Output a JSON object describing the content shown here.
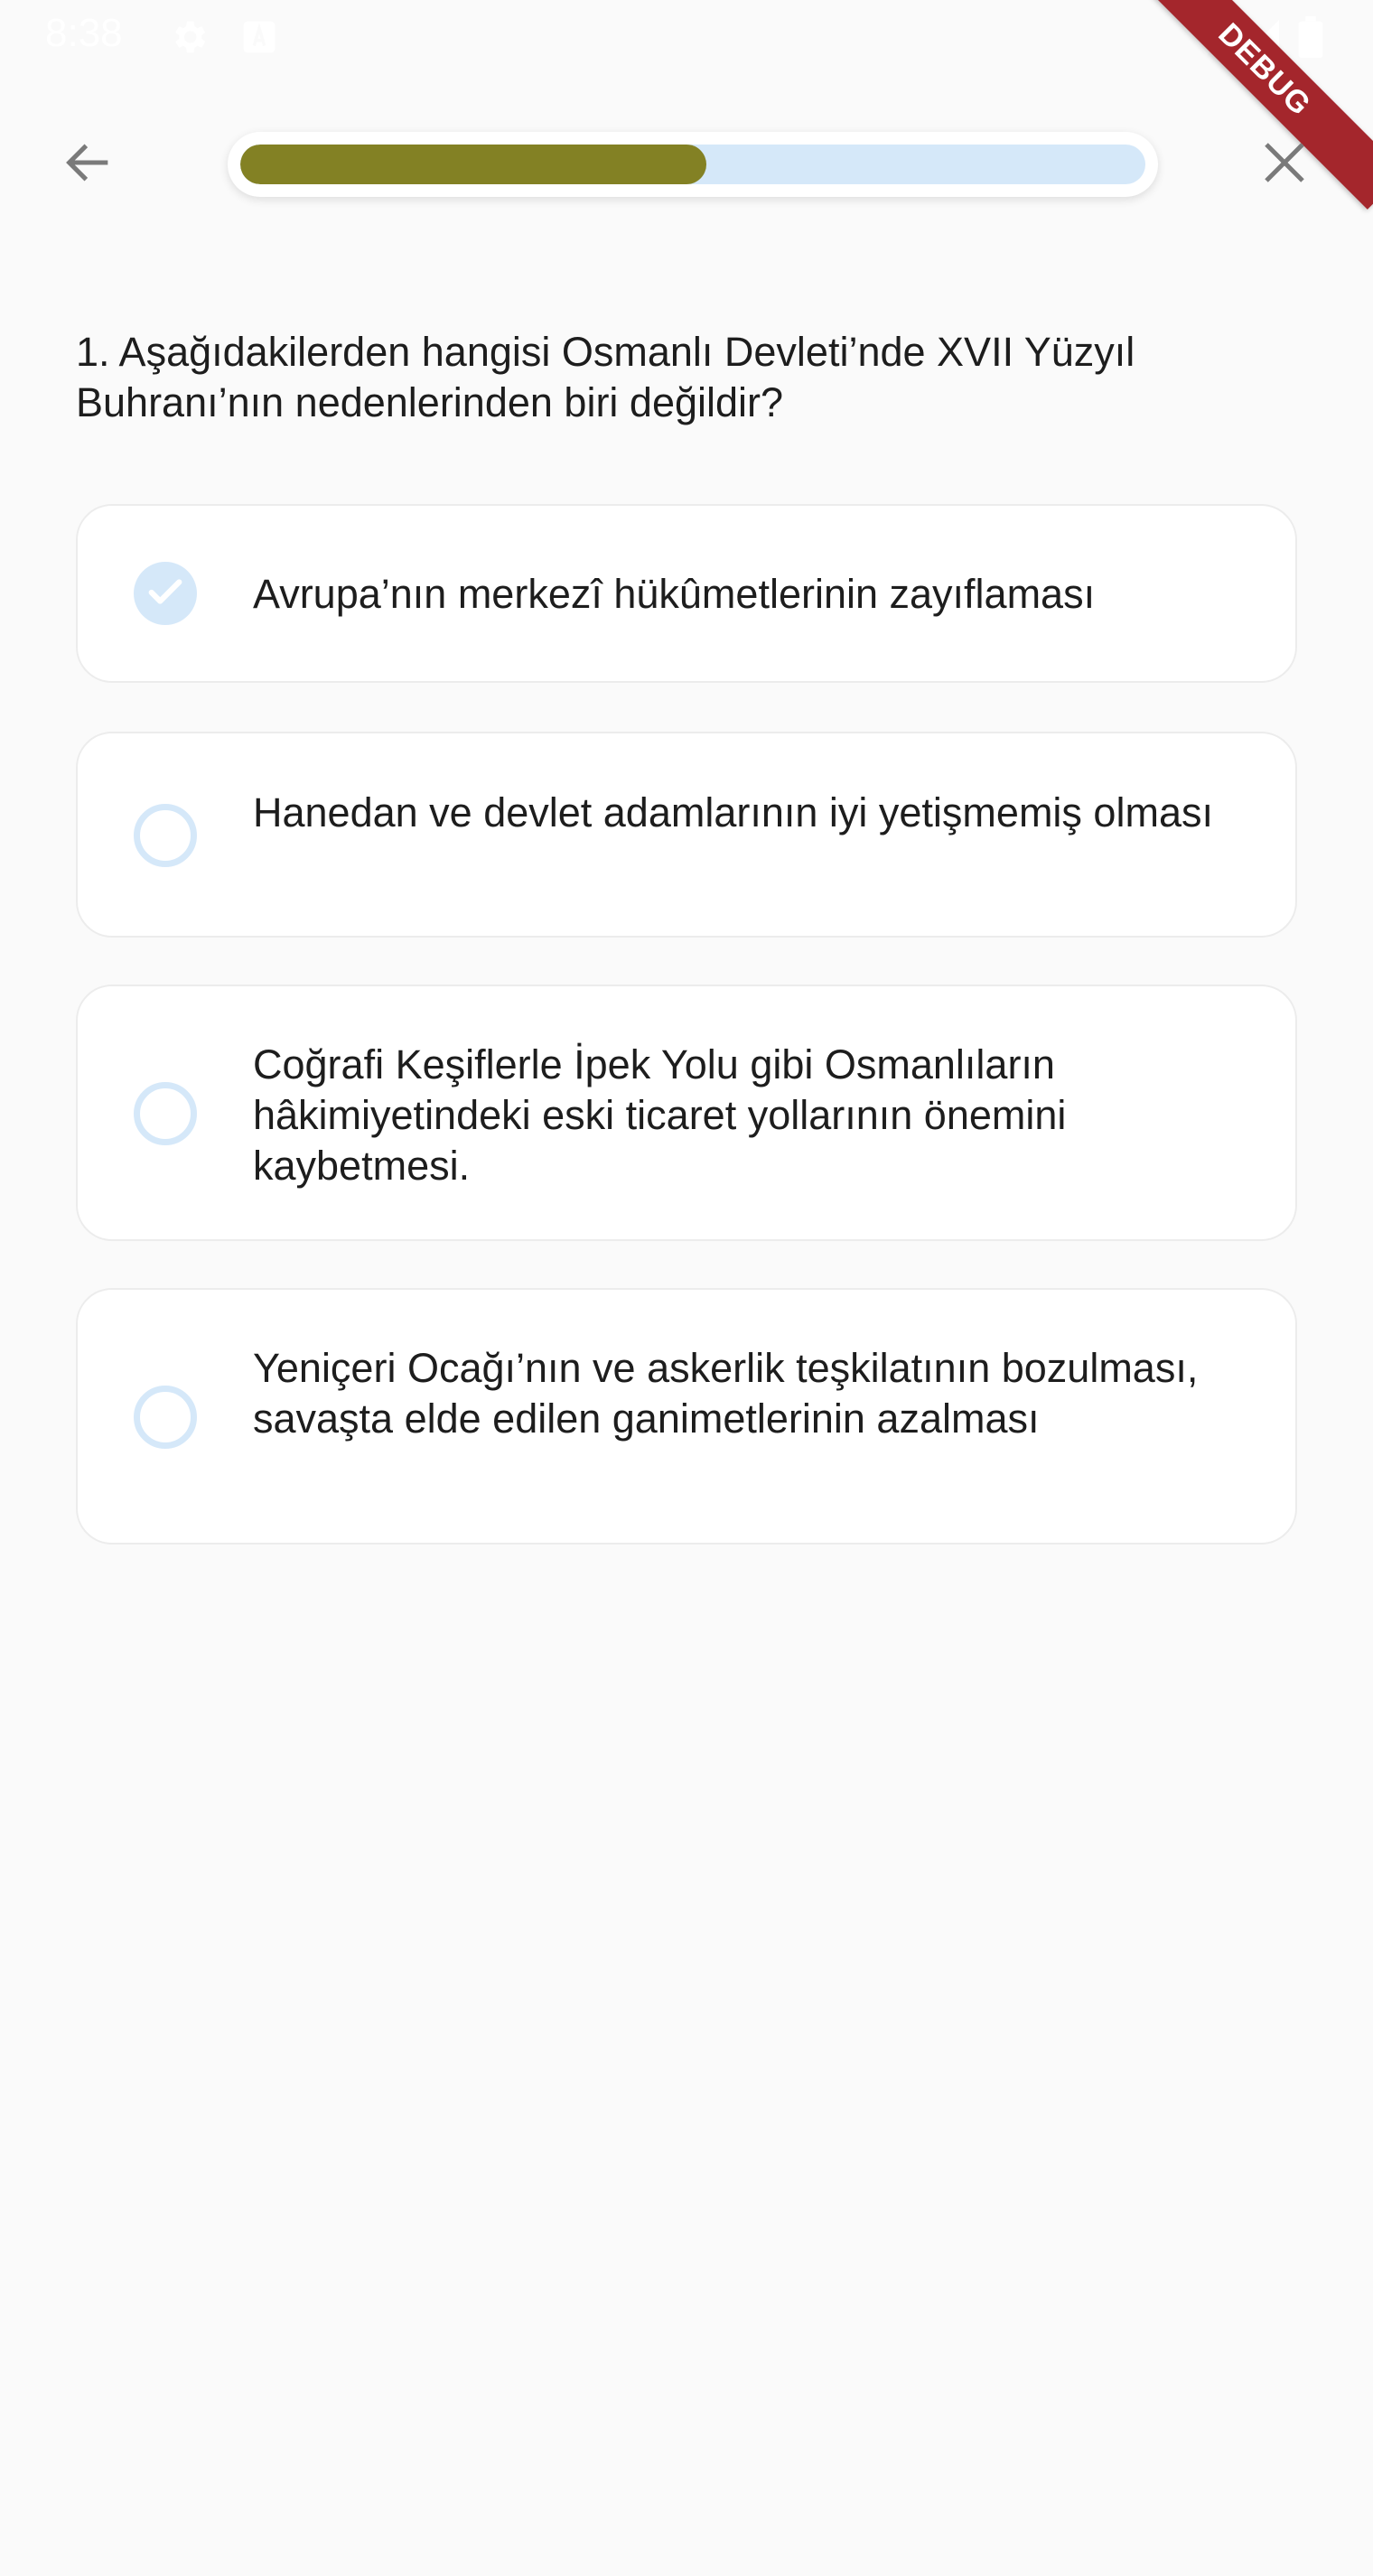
{
  "status_bar": {
    "time": "8:38",
    "icons": [
      "gear-icon",
      "font-icon",
      "wifi-icon",
      "signal-icon",
      "battery-icon"
    ]
  },
  "debug_banner": {
    "label": "DEBUG"
  },
  "header": {
    "back_icon": "arrow-back-icon",
    "close_icon": "close-icon",
    "progress": 0.515
  },
  "question": {
    "text": "1. Aşağıdakilerden hangisi Osmanlı Devleti’nde XVII Yüzyıl Buhranı’nın nedenlerinden biri değildir?"
  },
  "options": [
    {
      "text": "Avrupa’nın merkezî hükûmetlerinin zayıflaması",
      "selected": true
    },
    {
      "text": "Hanedan ve devlet adamlarının iyi yetişmemiş olması",
      "selected": false
    },
    {
      "text": "Coğrafi Keşiflerle İpek Yolu gibi Osmanlıların hâkimiyetindeki eski ticaret yollarının önemini kaybetmesi.",
      "selected": false
    },
    {
      "text": "Yeniçeri Ocağı’nın ve askerlik teşkilatının bozulması, savaşta elde edilen ganimetlerinin azalması",
      "selected": false
    }
  ],
  "colors": {
    "progress_fill": "#838124",
    "progress_track": "#d5e8f9",
    "radio": "#d5e8f9",
    "debug_ribbon": "#a4262c"
  }
}
